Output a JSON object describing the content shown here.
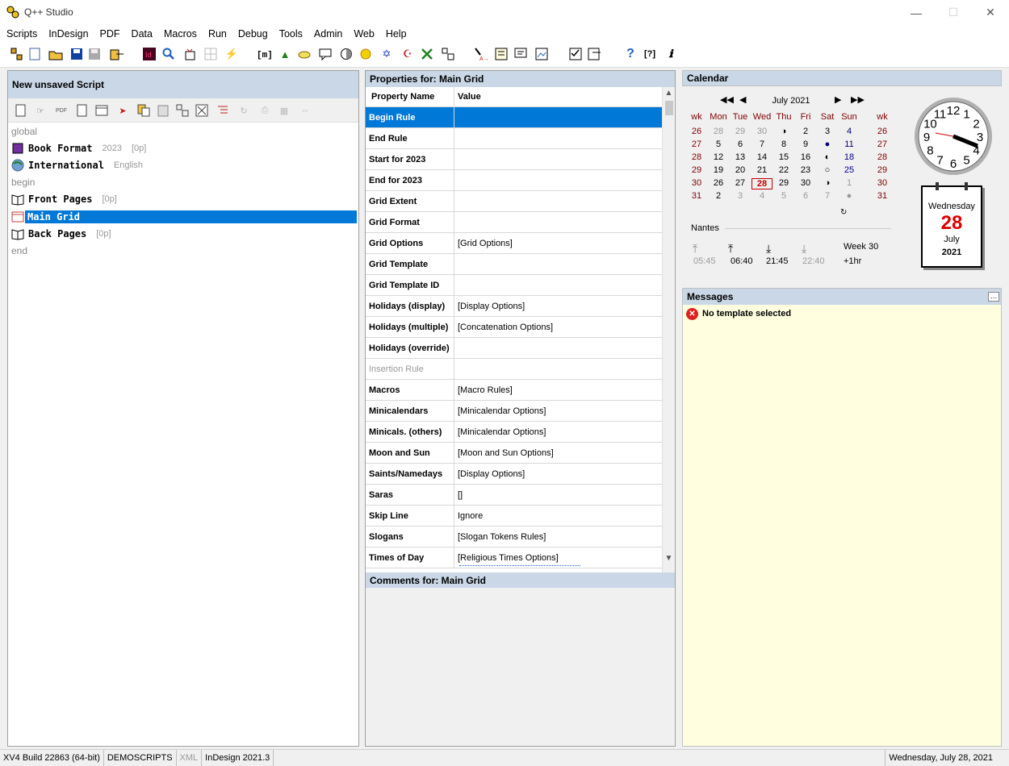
{
  "window": {
    "title": "Q++ Studio"
  },
  "menu": [
    "Scripts",
    "InDesign",
    "PDF",
    "Data",
    "Macros",
    "Run",
    "Debug",
    "Tools",
    "Admin",
    "Web",
    "Help"
  ],
  "script_panel": {
    "title": "New unsaved Script",
    "items": [
      {
        "kind": "kw",
        "label": "global"
      },
      {
        "kind": "item",
        "label": "Book Format",
        "meta1": "2023",
        "meta2": "[0p]",
        "icon": "book-icon"
      },
      {
        "kind": "item",
        "label": "International",
        "meta1": "English",
        "meta2": "",
        "icon": "globe-icon"
      },
      {
        "kind": "kw",
        "label": "begin"
      },
      {
        "kind": "item",
        "label": "Front Pages",
        "meta1": "[0p]",
        "meta2": "",
        "icon": "open-book-icon"
      },
      {
        "kind": "item",
        "label": "Main Grid",
        "meta1": "",
        "meta2": "",
        "icon": "grid-icon",
        "selected": true
      },
      {
        "kind": "item",
        "label": "Back Pages",
        "meta1": "[0p]",
        "meta2": "",
        "icon": "open-book-icon"
      },
      {
        "kind": "kw",
        "label": "end"
      }
    ]
  },
  "properties": {
    "title": "Properties for: Main Grid",
    "col_name": "Property Name",
    "col_value": "Value",
    "rows": [
      {
        "name": "Begin Rule",
        "value": ""
      },
      {
        "name": "End Rule",
        "value": ""
      },
      {
        "name": "Start for 2023",
        "value": ""
      },
      {
        "name": "End for 2023",
        "value": ""
      },
      {
        "name": "Grid Extent",
        "value": ""
      },
      {
        "name": "Grid Format",
        "value": ""
      },
      {
        "name": "Grid Options",
        "value": "[Grid Options]"
      },
      {
        "name": "Grid Template",
        "value": ""
      },
      {
        "name": "Grid Template ID",
        "value": ""
      },
      {
        "name": "Holidays (display)",
        "value": "[Display Options]"
      },
      {
        "name": "Holidays (multiple)",
        "value": "[Concatenation Options]"
      },
      {
        "name": "Holidays (override)",
        "value": ""
      },
      {
        "name": "Insertion Rule",
        "value": ""
      },
      {
        "name": "Macros",
        "value": "[Macro Rules]"
      },
      {
        "name": "Minicalendars",
        "value": "[Minicalendar Options]"
      },
      {
        "name": "Minicals. (others)",
        "value": "[Minicalendar Options]"
      },
      {
        "name": "Moon and Sun",
        "value": "[Moon and Sun Options]"
      },
      {
        "name": "Saints/Namedays",
        "value": "[Display Options]"
      },
      {
        "name": "Saras",
        "value": "[]"
      },
      {
        "name": "Skip Line",
        "value": "Ignore"
      },
      {
        "name": "Slogans",
        "value": "[Slogan Tokens Rules]"
      },
      {
        "name": "Times of Day",
        "value": "[Religious Times Options]"
      }
    ],
    "comments_title": "Comments for: Main Grid"
  },
  "calendar": {
    "title": "Calendar",
    "month": "July 2021",
    "headers": [
      "wk",
      "Mon",
      "Tue",
      "Wed",
      "Thu",
      "Fri",
      "Sat",
      "Sun",
      "wk"
    ],
    "weeks": [
      [
        "26",
        "28",
        "29",
        "30",
        "◑",
        "2",
        "3",
        "4",
        "26"
      ],
      [
        "27",
        "5",
        "6",
        "7",
        "8",
        "9",
        "●",
        "11",
        "27"
      ],
      [
        "28",
        "12",
        "13",
        "14",
        "15",
        "16",
        "◐",
        "18",
        "28"
      ],
      [
        "29",
        "19",
        "20",
        "21",
        "22",
        "23",
        "○",
        "25",
        "29"
      ],
      [
        "30",
        "26",
        "27",
        "28",
        "29",
        "30",
        "◑",
        "1",
        "30"
      ],
      [
        "31",
        "2",
        "3",
        "4",
        "5",
        "6",
        "7",
        "●",
        "31"
      ]
    ],
    "location": "Nantes",
    "sun_times": [
      "05:45",
      "06:40",
      "21:45",
      "22:40"
    ],
    "week_label": "Week 30",
    "tz": "+1hr",
    "page_day": "Wednesday",
    "page_date": "28",
    "page_month": "July",
    "page_year": "2021",
    "clock_numbers": [
      "12",
      "1",
      "2",
      "3",
      "4",
      "5",
      "6",
      "7",
      "8",
      "9",
      "10",
      "11"
    ]
  },
  "messages": {
    "title": "Messages",
    "items": [
      "No template selected"
    ]
  },
  "status": {
    "build": "XV4 Build 22863 (64-bit)",
    "scripts": "DEMOSCRIPTS",
    "xml": "XML",
    "indesign": "InDesign 2021.3",
    "date": "Wednesday, July 28, 2021"
  }
}
